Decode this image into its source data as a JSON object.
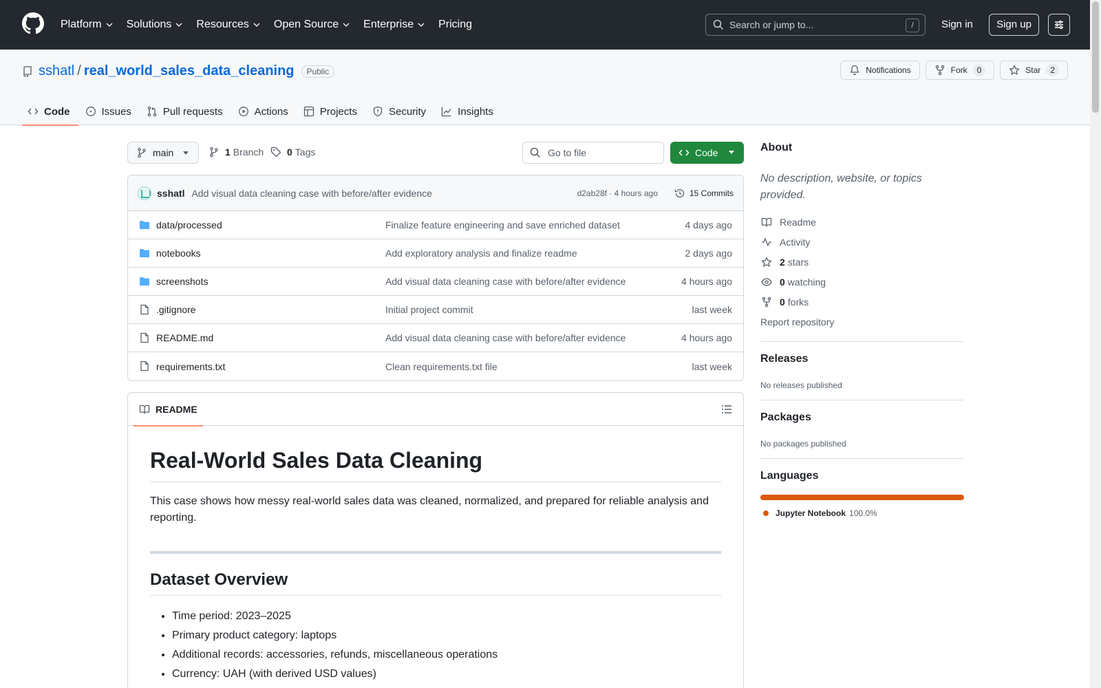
{
  "header": {
    "nav": [
      "Platform",
      "Solutions",
      "Resources",
      "Open Source",
      "Enterprise",
      "Pricing"
    ],
    "search_placeholder": "Search or jump to...",
    "search_shortcut": "/",
    "signin": "Sign in",
    "signup": "Sign up"
  },
  "repo": {
    "owner": "sshatl",
    "separator": "/",
    "name": "real_world_sales_data_cleaning",
    "visibility": "Public",
    "notifications": "Notifications",
    "fork_label": "Fork",
    "fork_count": "0",
    "star_label": "Star",
    "star_count": "2",
    "tabs": [
      "Code",
      "Issues",
      "Pull requests",
      "Actions",
      "Projects",
      "Security",
      "Insights"
    ]
  },
  "filenav": {
    "branch": "main",
    "branch_count": "1",
    "branch_label": "Branch",
    "tag_count": "0",
    "tag_label": "Tags",
    "goto_placeholder": "Go to file",
    "code_button": "Code"
  },
  "commit": {
    "author": "sshatl",
    "message": "Add visual data cleaning case with before/after evidence",
    "meta": "d2ab28f · 4 hours ago",
    "commits": "15 Commits"
  },
  "files": [
    {
      "type": "dir",
      "name": "data/processed",
      "commit": "Finalize feature engineering and save enriched dataset",
      "date": "4 days ago"
    },
    {
      "type": "dir",
      "name": "notebooks",
      "commit": "Add exploratory analysis and finalize readme",
      "date": "2 days ago"
    },
    {
      "type": "dir",
      "name": "screenshots",
      "commit": "Add visual data cleaning case with before/after evidence",
      "date": "4 hours ago"
    },
    {
      "type": "file",
      "name": ".gitignore",
      "commit": "Initial project commit",
      "date": "last week"
    },
    {
      "type": "file",
      "name": "README.md",
      "commit": "Add visual data cleaning case with before/after evidence",
      "date": "4 hours ago"
    },
    {
      "type": "file",
      "name": "requirements.txt",
      "commit": "Clean requirements.txt file",
      "date": "last week"
    }
  ],
  "readme": {
    "tab": "README",
    "h1": "Real-World Sales Data Cleaning",
    "intro": "This case shows how messy real-world sales data was cleaned, normalized, and prepared for reliable analysis and reporting.",
    "h2": "Dataset Overview",
    "list": [
      "Time period: 2023–2025",
      "Primary product category: laptops",
      "Additional records: accessories, refunds, miscellaneous operations",
      "Currency: UAH (with derived USD values)"
    ]
  },
  "sidebar": {
    "about_title": "About",
    "about_desc": "No description, website, or topics provided.",
    "readme": "Readme",
    "activity": "Activity",
    "stars_count": "2",
    "stars_label": "stars",
    "watching_count": "0",
    "watching_label": "watching",
    "forks_count": "0",
    "forks_label": "forks",
    "report": "Report repository",
    "releases_title": "Releases",
    "releases_text": "No releases published",
    "packages_title": "Packages",
    "packages_text": "No packages published",
    "languages_title": "Languages",
    "language_name": "Jupyter Notebook",
    "language_percent": "100.0%",
    "language_color": "#da5b0b"
  },
  "colors": {
    "header_bg": "#24292f",
    "link": "#0969da",
    "code_button": "#1f883d",
    "tab_underline": "#fd8c73",
    "folder": "#54aeff"
  }
}
